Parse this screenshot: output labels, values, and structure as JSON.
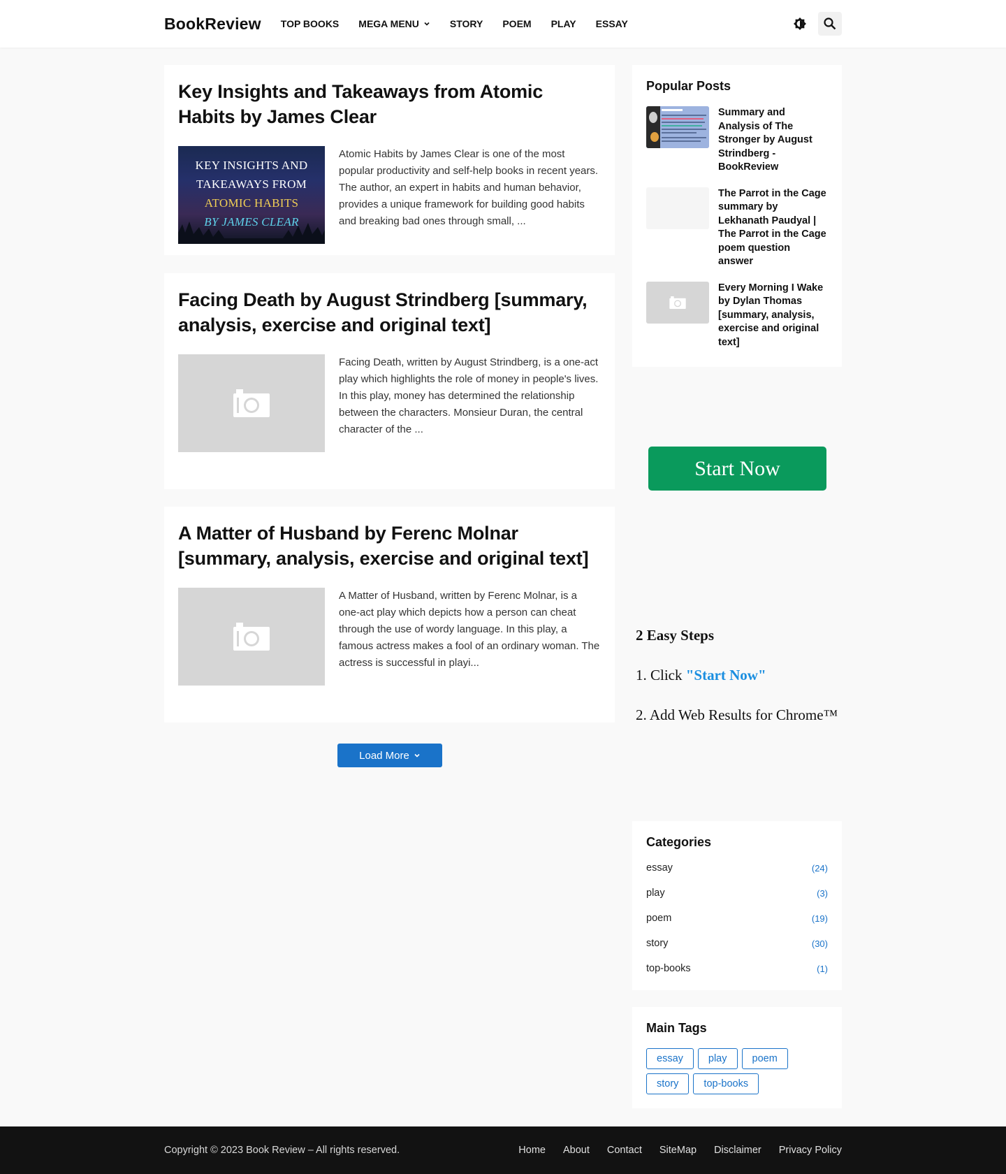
{
  "header": {
    "logo": "BookReview",
    "nav": [
      "TOP BOOKS",
      "MEGA MENU",
      "STORY",
      "POEM",
      "PLAY",
      "ESSAY"
    ],
    "icons": {
      "theme": "dark-mode-toggle-icon",
      "search": "search-icon"
    }
  },
  "posts": [
    {
      "title": "Key Insights and Takeaways from Atomic Habits by James Clear",
      "excerpt": "Atomic Habits by James Clear is one of the most popular productivity and self-help books in recent years. The author, an expert in habits and human behavior, provides a unique framework for building good habits and breaking bad ones through small, ...",
      "thumb_text": [
        "KEY INSIGHTS AND",
        "TAKEAWAYS FROM",
        "ATOMIC HABITS",
        "BY JAMES CLEAR"
      ]
    },
    {
      "title": "Facing Death by August Strindberg [summary, analysis, exercise and original text]",
      "excerpt": "Facing Death, written by August Strindberg, is a one-act play which highlights the role of money in people's lives. In this play, money has determined the relationship between the characters. Monsieur Duran, the central character of the ..."
    },
    {
      "title": "A Matter of Husband by Ferenc Molnar [summary, analysis, exercise and original text]",
      "excerpt": "A Matter of Husband, written by Ferenc Molnar, is a one-act play which depicts how a person can cheat through the use of wordy language. In this play, a famous actress makes a fool of an ordinary woman. The actress is successful in playi..."
    }
  ],
  "load_more": "Load More",
  "popular": {
    "title": "Popular Posts",
    "items": [
      "Summary and Analysis of The Stronger by August Strindberg - BookReview",
      "The Parrot in the Cage summary by Lekhanath Paudyal | The Parrot in the Cage poem question answer",
      "Every Morning I Wake by Dylan Thomas [summary, analysis, exercise and original text]"
    ]
  },
  "ad": {
    "button": "Start Now",
    "heading": "2 Easy Steps",
    "step1_prefix": "1. Click ",
    "step1_link": "\"Start Now\"",
    "step2": "2. Add Web Results for Chrome™"
  },
  "categories": {
    "title": "Categories",
    "items": [
      {
        "name": "essay",
        "count": "(24)"
      },
      {
        "name": "play",
        "count": "(3)"
      },
      {
        "name": "poem",
        "count": "(19)"
      },
      {
        "name": "story",
        "count": "(30)"
      },
      {
        "name": "top-books",
        "count": "(1)"
      }
    ]
  },
  "tags": {
    "title": "Main Tags",
    "items": [
      "essay",
      "play",
      "poem",
      "story",
      "top-books"
    ]
  },
  "footer": {
    "copyright": "Copyright © 2023 Book Review – All rights reserved.",
    "links": [
      "Home",
      "About",
      "Contact",
      "SiteMap",
      "Disclaimer",
      "Privacy Policy"
    ]
  },
  "colors": {
    "accent": "#1a73c9",
    "ad_button": "#0a9a5c",
    "footer_bg": "#121212",
    "placeholder": "#d6d6d6"
  }
}
